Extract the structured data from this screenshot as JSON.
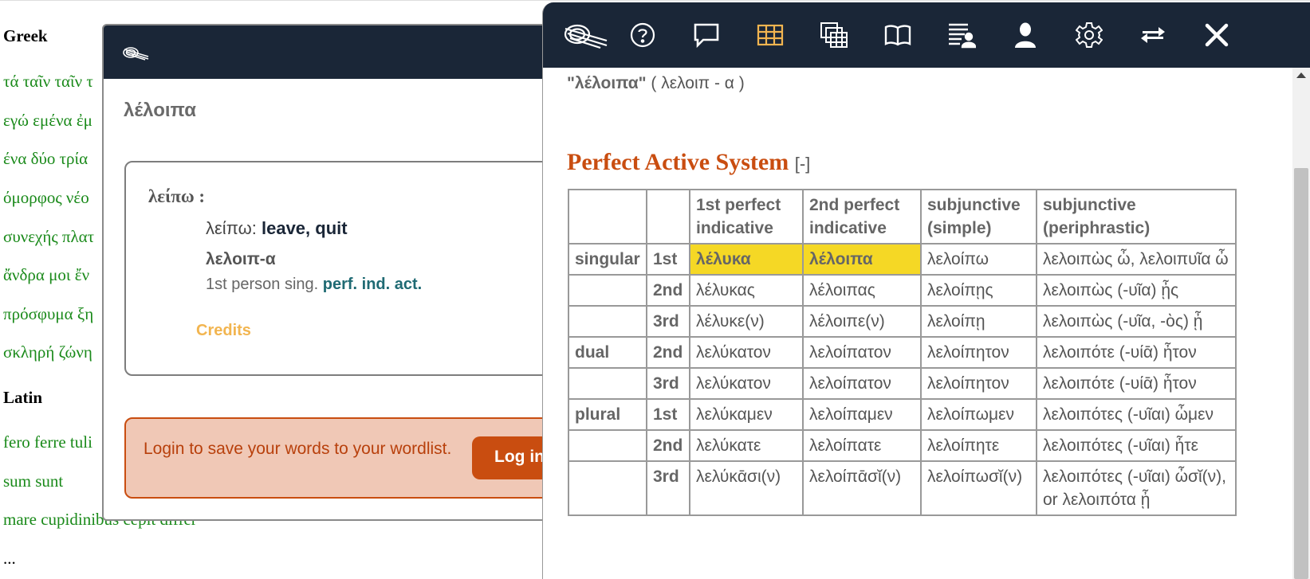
{
  "background": {
    "sections": [
      {
        "heading": "Greek",
        "lines": [
          "τά ταῖν ταῖν τ",
          "εγώ εμένα ἐμ",
          "ένα δύο τρία",
          "όμορφος νέο",
          "συνεχής πλατ",
          "ἄνδρα μοι ἔν",
          "πρόσφυμα ξη",
          "σκληρή ζώνη"
        ]
      },
      {
        "heading": "Latin",
        "lines": [
          "fero ferre tuli",
          "sum sunt",
          "mare cupidinibus cepit differ",
          "..."
        ]
      }
    ]
  },
  "popup": {
    "word": "λέλοιπα",
    "lemma": "λείπω :",
    "definition_lemma": "λείπω:",
    "definition_text": "leave, quit",
    "form": "λελοιπ-α",
    "morph_prefix": "1st person sing.",
    "morph_tag": "perf. ind. act.",
    "credits": "Credits",
    "login_message": "Login to save your words to your wordlist.",
    "login_button": "Log in"
  },
  "panel": {
    "toolbar": [
      {
        "name": "alpheios-logo-button",
        "icon": "alpheios-logo-icon"
      },
      {
        "name": "help-button",
        "icon": "question-icon"
      },
      {
        "name": "definitions-button",
        "icon": "speech-bubble-icon"
      },
      {
        "name": "inflections-button",
        "icon": "table-icon",
        "active_color": "#f2b550"
      },
      {
        "name": "inflections-browser-button",
        "icon": "stacked-tables-icon"
      },
      {
        "name": "grammar-button",
        "icon": "open-book-icon"
      },
      {
        "name": "wordlist-button",
        "icon": "list-person-icon"
      },
      {
        "name": "user-button",
        "icon": "user-icon"
      },
      {
        "name": "options-button",
        "icon": "gear-icon"
      },
      {
        "name": "swap-position-button",
        "icon": "swap-arrows-icon"
      },
      {
        "name": "close-panel-button",
        "icon": "close-icon"
      }
    ],
    "inflection_word": "\"λέλοιπα\"",
    "inflection_stem": "( λελοιπ - α )",
    "section_title": "Perfect Active System",
    "section_toggle": "[-]",
    "table": {
      "headers": [
        "",
        "",
        "1st perfect indicative",
        "2nd perfect indicative",
        "subjunctive (simple)",
        "subjunctive (periphrastic)"
      ],
      "rows": [
        {
          "number": "singular",
          "person": "1st",
          "cells": [
            "λέλυκα",
            "λέλοιπα",
            "λελοίπω",
            "λελοιπὼς ὦ, λελοιπυῖα ὦ"
          ],
          "highlight": [
            0,
            1
          ]
        },
        {
          "number": "",
          "person": "2nd",
          "cells": [
            "λέλυκας",
            "λέλοιπας",
            "λελοίπῃς",
            "λελοιπὼς (-υῖα) ᾖς"
          ],
          "highlight": []
        },
        {
          "number": "",
          "person": "3rd",
          "cells": [
            "λέλυκε(ν)",
            "λέλοιπε(ν)",
            "λελοίπῃ",
            "λελοιπὼς (-υῖα, -ὸς) ᾖ"
          ],
          "highlight": []
        },
        {
          "number": "dual",
          "person": "2nd",
          "cells": [
            "λελύκατον",
            "λελοίπατον",
            "λελοίπητον",
            "λελοιπότε (-υίᾱ) ἦτον"
          ],
          "highlight": []
        },
        {
          "number": "",
          "person": "3rd",
          "cells": [
            "λελύκατον",
            "λελοίπατον",
            "λελοίπητον",
            "λελοιπότε (-υίᾱ) ἦτον"
          ],
          "highlight": []
        },
        {
          "number": "plural",
          "person": "1st",
          "cells": [
            "λελύκαμεν",
            "λελοίπαμεν",
            "λελοίπωμεν",
            "λελοιπότες (-υῖαι) ὦμεν"
          ],
          "highlight": []
        },
        {
          "number": "",
          "person": "2nd",
          "cells": [
            "λελύκατε",
            "λελοίπατε",
            "λελοίπητε",
            "λελοιπότες (-υῖαι) ἦτε"
          ],
          "highlight": []
        },
        {
          "number": "",
          "person": "3rd",
          "cells": [
            "λελύκᾱσι(ν)",
            "λελοίπᾱσῐ(ν)",
            "λελοίπωσῐ(ν)",
            "λελοιπότες (-υῖαι) ὦσῐ(ν), or λελοιπότα ᾖ"
          ],
          "highlight": []
        }
      ]
    }
  },
  "colors": {
    "toolbar_bg": "#1a2637",
    "accent_orange": "#c94d10",
    "highlight_yellow": "#f5d825",
    "credits_gold": "#f2b550",
    "greek_green": "#1a8a1a"
  }
}
